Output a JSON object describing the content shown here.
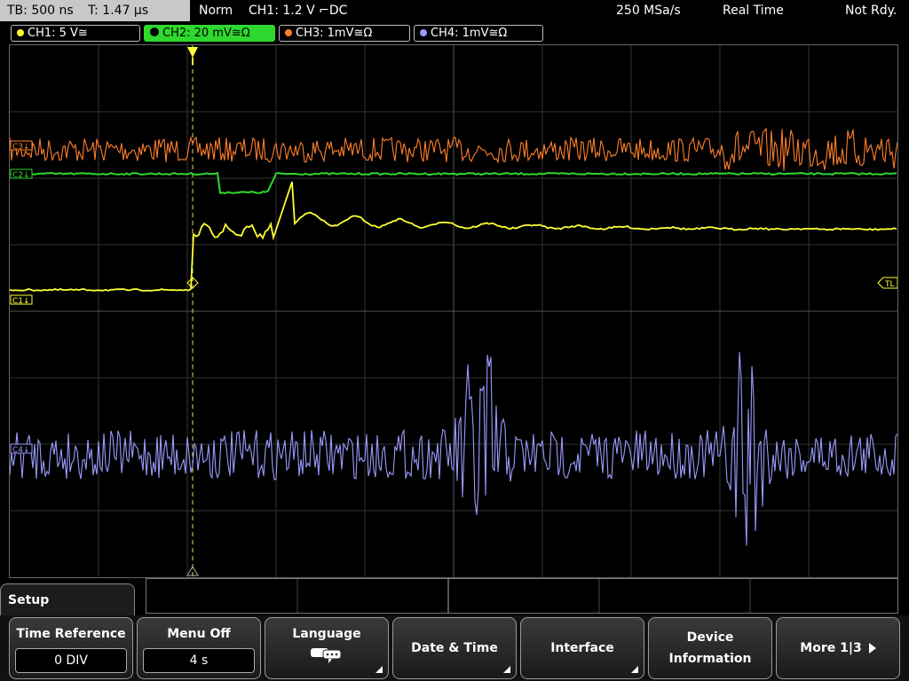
{
  "topbar": {
    "timebase": "TB: 500 ns",
    "trigger_time": "T: 1.47 µs",
    "mode": "Norm",
    "trigger_source": "CH1: 1.2 V ⌐DC",
    "sample_rate": "250 MSa/s",
    "acq_mode": "Real Time",
    "status": "Not Rdy."
  },
  "channels": [
    {
      "label": "CH1: 5 V≅",
      "color": "#ffff33"
    },
    {
      "label": "CH2: 20 mV≅Ω",
      "color": "#2ed82e",
      "active": true
    },
    {
      "label": "CH3: 1mV≅Ω",
      "color": "#ff7f2a"
    },
    {
      "label": "CH4: 1mV≅Ω",
      "color": "#9b9bff"
    }
  ],
  "markers": {
    "ch1": "C1↓",
    "ch2": "C2↓",
    "ch3": "C3↓",
    "ch4": "C4↓",
    "trigger_level": "TL",
    "trigger_pos": "T"
  },
  "setup": {
    "title": "Setup"
  },
  "softkeys": [
    {
      "label": "Time Reference",
      "value": "0 DIV"
    },
    {
      "label": "Menu Off",
      "value": "4 s"
    },
    {
      "label": "Language",
      "icon": "speech-bubble-icon"
    },
    {
      "label": "Date & Time"
    },
    {
      "label": "Interface"
    },
    {
      "label1": "Device",
      "label2": "Information"
    },
    {
      "label": "More 1|3"
    }
  ]
}
